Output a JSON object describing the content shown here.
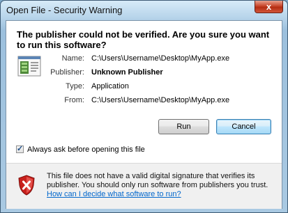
{
  "window": {
    "title": "Open File - Security Warning",
    "close_glyph": "x"
  },
  "headline": "The publisher could not be verified.  Are you sure you want to run this software?",
  "details": [
    {
      "label": "Name:",
      "value": "C:\\Users\\Username\\Desktop\\MyApp.exe",
      "bold": false
    },
    {
      "label": "Publisher:",
      "value": "Unknown Publisher",
      "bold": true
    },
    {
      "label": "Type:",
      "value": "Application",
      "bold": false
    },
    {
      "label": "From:",
      "value": "C:\\Users\\Username\\Desktop\\MyApp.exe",
      "bold": false
    }
  ],
  "buttons": {
    "run": "Run",
    "cancel": "Cancel"
  },
  "checkbox": {
    "label": "Always ask before opening this file",
    "checked": true,
    "mark": "✓"
  },
  "warning": {
    "text": "This file does not have a valid digital signature that verifies its publisher.  You should only run software from publishers you trust.",
    "link": "How can I decide what software to run?"
  },
  "icons": {
    "app": "application-icon",
    "shield": "shield-warning-icon"
  },
  "colors": {
    "link": "#0066cc",
    "shield": "#c8201c"
  }
}
